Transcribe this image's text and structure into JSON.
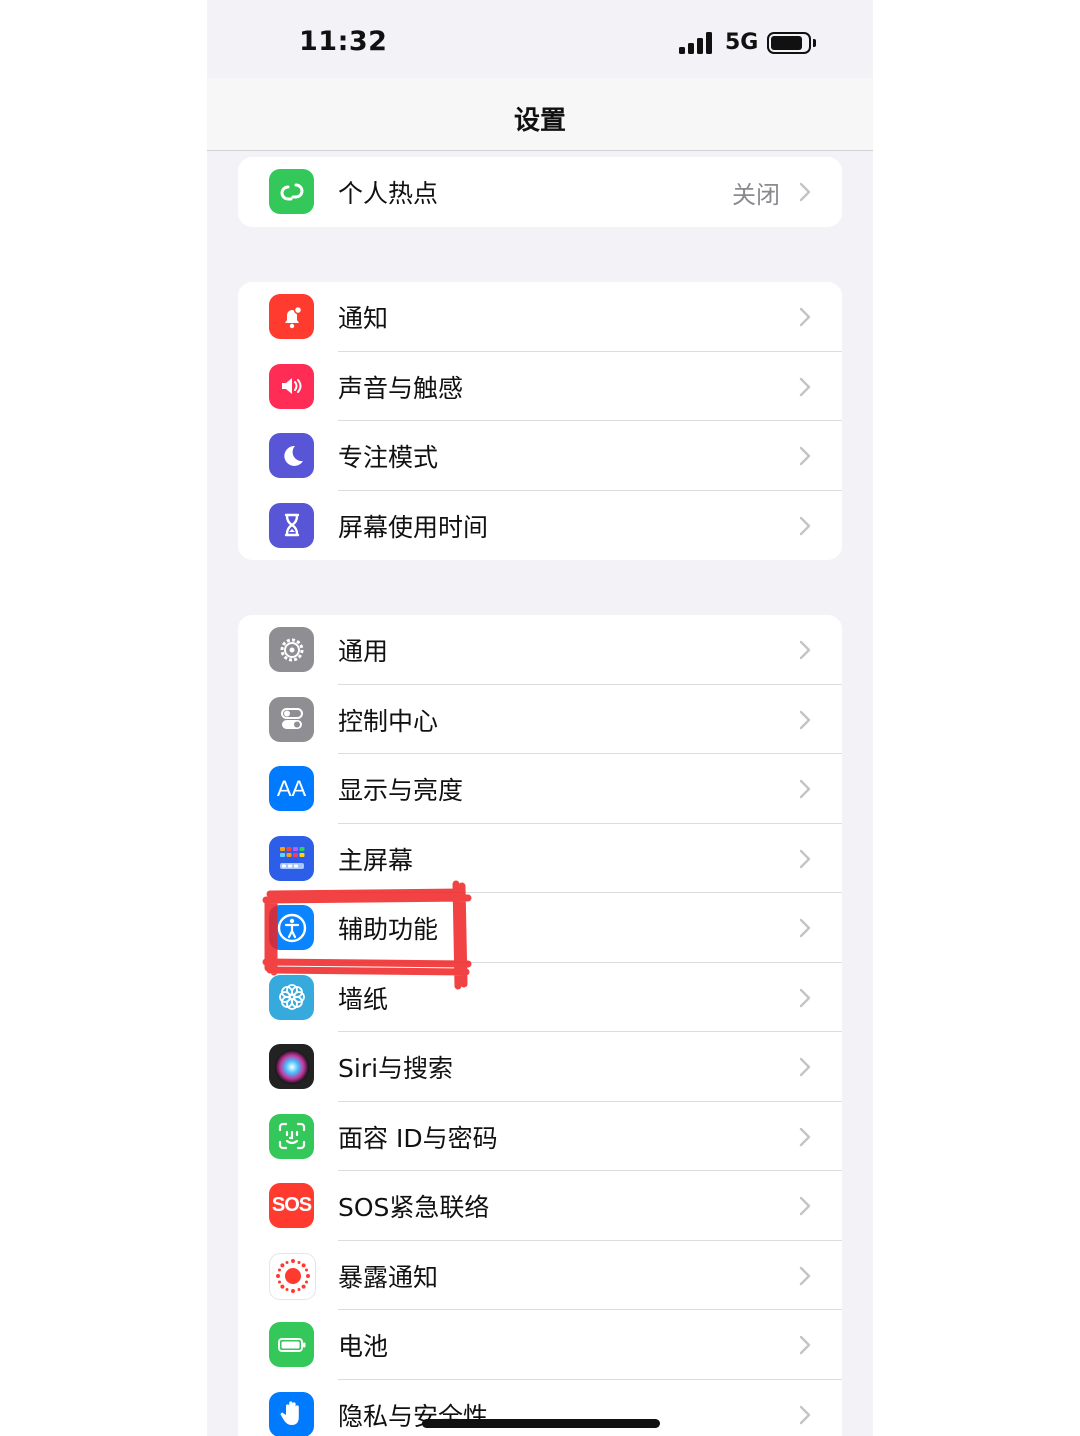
{
  "status_bar": {
    "time": "11:32",
    "network": "5G",
    "battery_level": 0.9
  },
  "nav": {
    "title": "设置"
  },
  "groups": [
    {
      "rows": [
        {
          "id": "hotspot",
          "label": "个人热点",
          "value": "关闭",
          "icon": "hotspot-icon",
          "color": "#34c759"
        }
      ]
    },
    {
      "rows": [
        {
          "id": "notifications",
          "label": "通知",
          "icon": "bell-icon",
          "color": "#ff3b30"
        },
        {
          "id": "sounds",
          "label": "声音与触感",
          "icon": "speaker-icon",
          "color": "#ff2d55"
        },
        {
          "id": "focus",
          "label": "专注模式",
          "icon": "moon-icon",
          "color": "#5856d6"
        },
        {
          "id": "screentime",
          "label": "屏幕使用时间",
          "icon": "hourglass-icon",
          "color": "#5856d6"
        }
      ]
    },
    {
      "rows": [
        {
          "id": "general",
          "label": "通用",
          "icon": "gear-icon",
          "color": "#8e8e93"
        },
        {
          "id": "control",
          "label": "控制中心",
          "icon": "toggles-icon",
          "color": "#8e8e93"
        },
        {
          "id": "display",
          "label": "显示与亮度",
          "icon": "text-size-icon",
          "color": "#007aff",
          "glyph": "AA"
        },
        {
          "id": "home",
          "label": "主屏幕",
          "icon": "home-grid-icon",
          "color": "#2c5ee8"
        },
        {
          "id": "accessibility",
          "label": "辅助功能",
          "icon": "accessibility-icon",
          "color": "#0a84ff"
        },
        {
          "id": "wallpaper",
          "label": "墙纸",
          "icon": "flower-icon",
          "color": "#36aadc"
        },
        {
          "id": "siri",
          "label": "Siri与搜索",
          "icon": "siri-icon",
          "color": "#222222"
        },
        {
          "id": "faceid",
          "label": "面容 ID与密码",
          "icon": "faceid-icon",
          "color": "#34c759"
        },
        {
          "id": "sos",
          "label": "SOS紧急联络",
          "icon": "sos-icon",
          "color": "#ff3b30",
          "glyph": "SOS"
        },
        {
          "id": "exposure",
          "label": "暴露通知",
          "icon": "exposure-icon",
          "color": "#ffffff"
        },
        {
          "id": "battery",
          "label": "电池",
          "icon": "battery-icon",
          "color": "#34c759"
        },
        {
          "id": "privacy",
          "label": "隐私与安全性",
          "icon": "hand-icon",
          "color": "#007aff"
        }
      ]
    }
  ],
  "highlight": {
    "target": "accessibility",
    "color": "#ee2222"
  }
}
